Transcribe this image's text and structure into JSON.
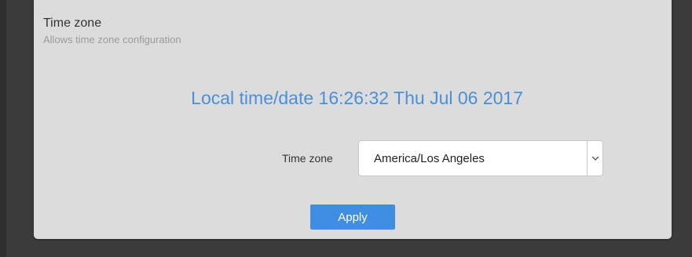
{
  "section": {
    "title": "Time zone",
    "subtitle": "Allows time zone configuration"
  },
  "local_time": {
    "text": "Local time/date 16:26:32 Thu Jul 06 2017"
  },
  "timezone_field": {
    "label": "Time zone",
    "selected_value": "America/Los Angeles",
    "arrow_icon": "chevron-down-icon"
  },
  "actions": {
    "apply_label": "Apply"
  },
  "colors": {
    "accent": "#3f8ee4",
    "local_time_text": "#4a90d9",
    "panel_background": "#dcdcdc",
    "page_background": "#3b3b3b"
  }
}
